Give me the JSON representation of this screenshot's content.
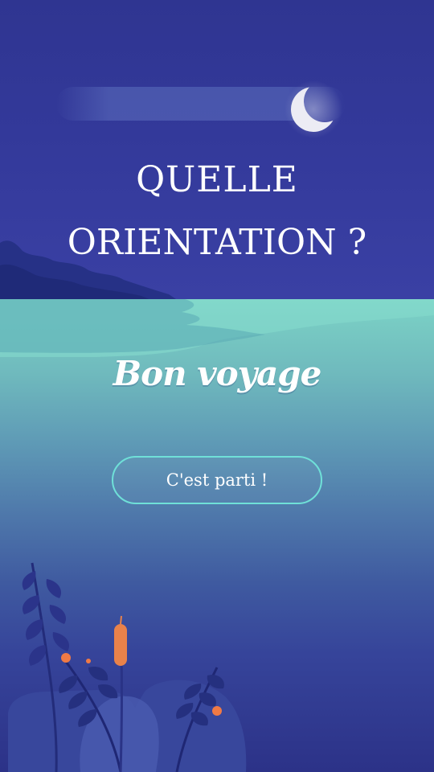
{
  "hero": {
    "title_line1": "QUELLE",
    "title_line2": "ORIENTATION ?",
    "subtitle": "Bon voyage",
    "cta_label": "C'est parti !"
  },
  "icons": {
    "moon": "crescent-moon-icon"
  },
  "colors": {
    "sky": "#33399a",
    "sea_top": "#7cd3c6",
    "sea_bottom": "#2c3288",
    "cta_border": "#6fe0d8",
    "text": "#ffffff",
    "accent_orange": "#f07a45"
  }
}
